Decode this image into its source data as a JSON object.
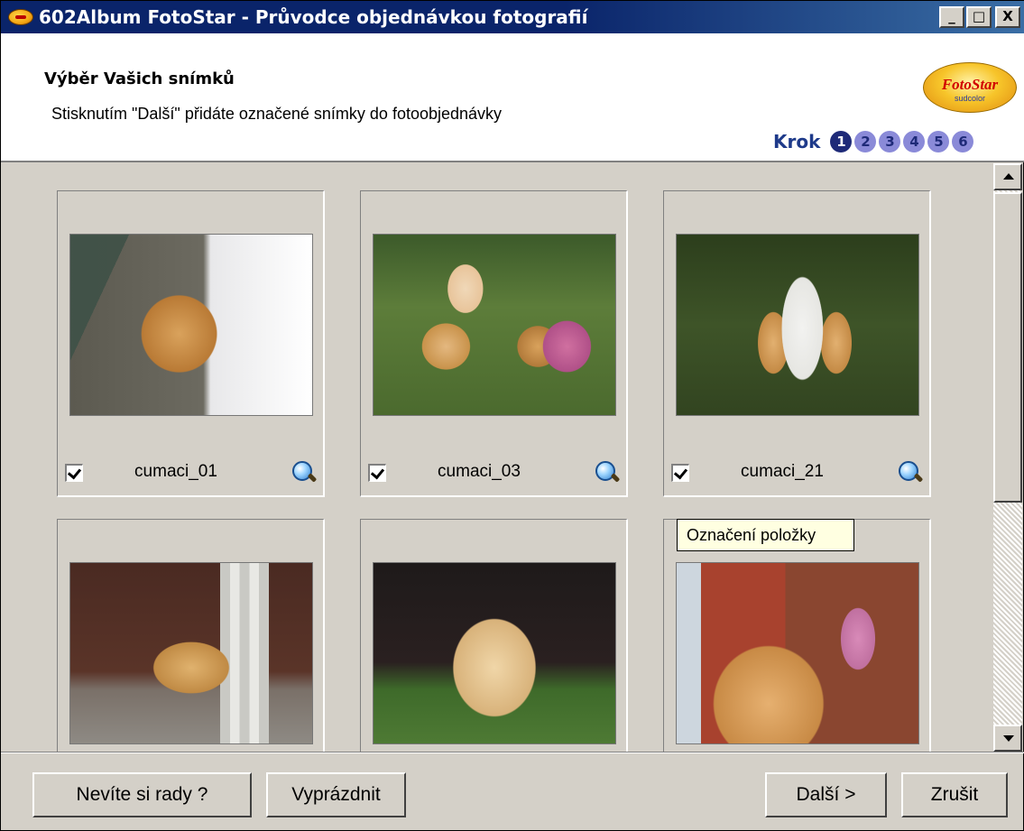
{
  "window": {
    "title": "602Album FotoStar - Průvodce objednávkou fotografií",
    "controls": {
      "minimize": "_",
      "maximize": "□",
      "close": "X"
    }
  },
  "header": {
    "title": "Výběr Vašich snímků",
    "subtitle": "Stisknutím \"Další\" přidáte označené snímky do fotoobjednávky",
    "logo": {
      "text": "FotoStar",
      "sub": "sudcolor"
    },
    "steps": {
      "label": "Krok",
      "items": [
        "1",
        "2",
        "3",
        "4",
        "5",
        "6"
      ],
      "current": 1
    }
  },
  "photos": [
    {
      "caption": "cumaci_01",
      "checked": true
    },
    {
      "caption": "cumaci_03",
      "checked": true
    },
    {
      "caption": "cumaci_21",
      "checked": true
    },
    {
      "caption": "",
      "checked": false
    },
    {
      "caption": "",
      "checked": false
    },
    {
      "caption": "",
      "checked": false
    }
  ],
  "tooltip": "Označení položky",
  "buttons": {
    "help": "Nevíte si rady ?",
    "clear": "Vyprázdnit",
    "next": "Další >",
    "cancel": "Zrušit"
  }
}
